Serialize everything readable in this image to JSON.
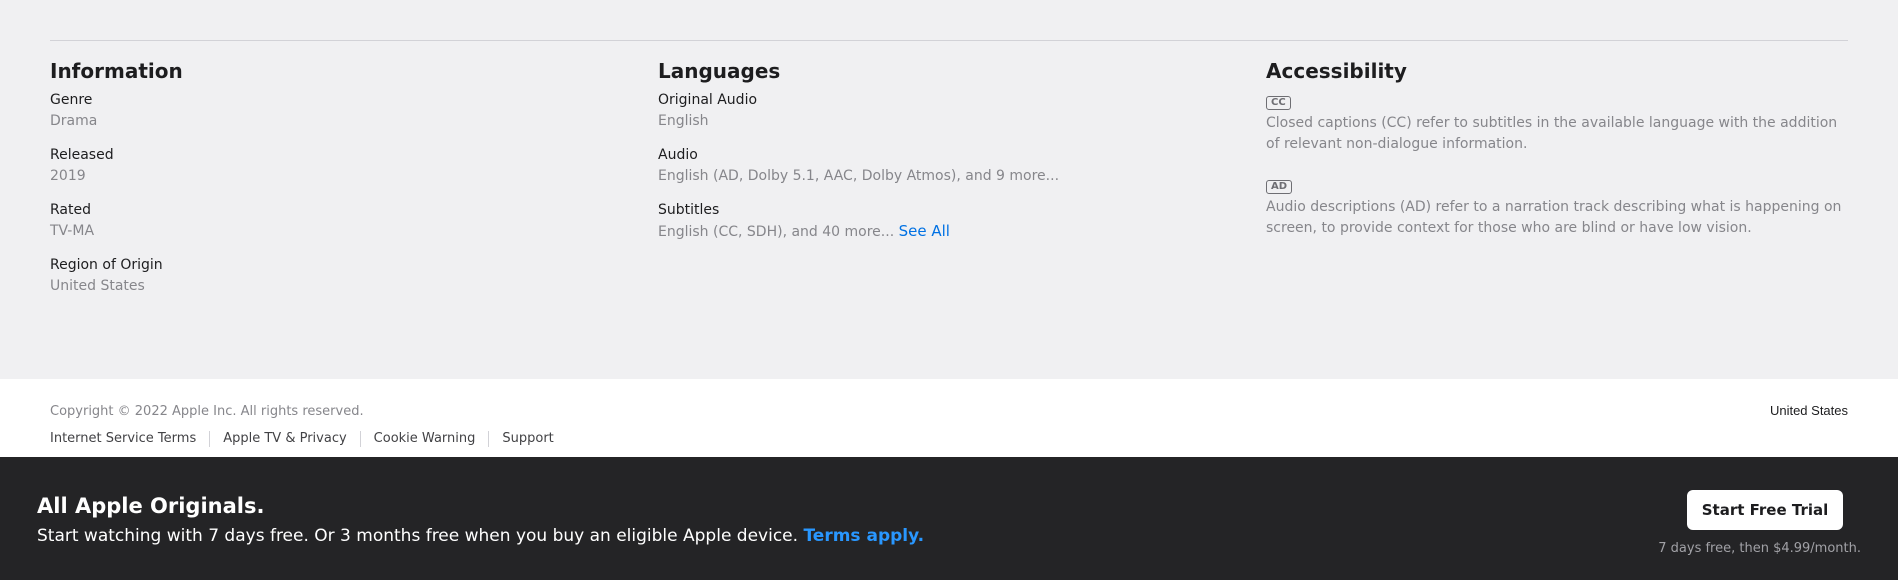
{
  "information": {
    "heading": "Information",
    "fields": [
      {
        "label": "Genre",
        "value": "Drama"
      },
      {
        "label": "Released",
        "value": "2019"
      },
      {
        "label": "Rated",
        "value": "TV-MA"
      },
      {
        "label": "Region of Origin",
        "value": "United States"
      }
    ]
  },
  "languages": {
    "heading": "Languages",
    "fields": [
      {
        "label": "Original Audio",
        "value": "English"
      },
      {
        "label": "Audio",
        "value": "English (AD, Dolby 5.1, AAC, Dolby Atmos), and 9 more..."
      },
      {
        "label": "Subtitles",
        "value": "English (CC, SDH), and 40 more...",
        "link": "See All"
      }
    ]
  },
  "accessibility": {
    "heading": "Accessibility",
    "items": [
      {
        "badge": "CC",
        "text": "Closed captions (CC) refer to subtitles in the available language with the addition of relevant non-dialogue information."
      },
      {
        "badge": "AD",
        "text": "Audio descriptions (AD) refer to a narration track describing what is happening on screen, to provide context for those who are blind or have low vision."
      }
    ]
  },
  "footer": {
    "copyright": "Copyright © 2022 Apple Inc. All rights reserved.",
    "links": [
      "Internet Service Terms",
      "Apple TV & Privacy",
      "Cookie Warning",
      "Support"
    ],
    "region": "United States"
  },
  "banner": {
    "title": "All Apple Originals.",
    "text": "Start watching with 7 days free. Or 3 months free when you buy an eligible Apple device.",
    "terms_link": "Terms apply.",
    "button_label": "Start Free Trial",
    "price_note": "7 days free, then $4.99/month."
  }
}
